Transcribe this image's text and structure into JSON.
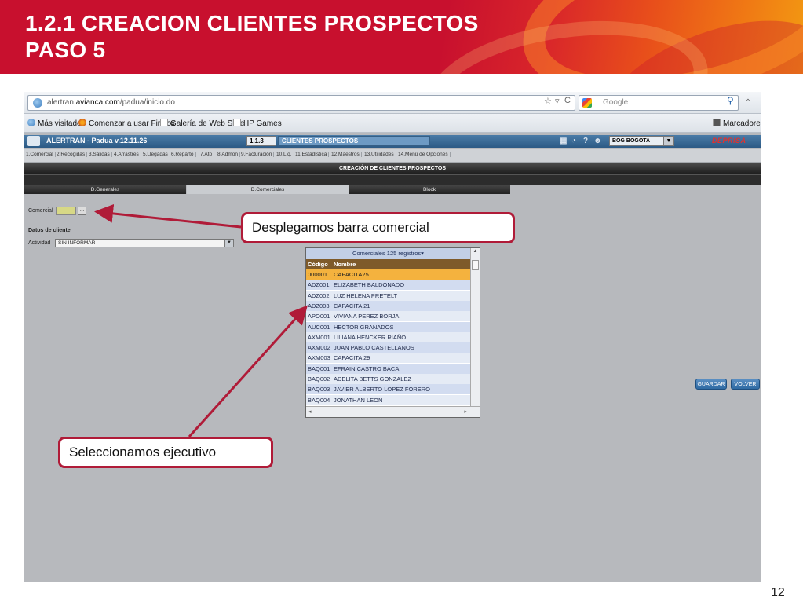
{
  "slide": {
    "title_line1": "1.2.1 CREACION CLIENTES PROSPECTOS",
    "title_line2": "PASO 5",
    "page_number": "12",
    "colors": {
      "header_red": "#c8102e",
      "header_orange": "#f39a12",
      "callout_border": "#b01b38"
    }
  },
  "browser": {
    "url_prefix": "alertran.",
    "url_domain": "avianca.com",
    "url_path": "/padua/inicio.do",
    "search_placeholder": "Google",
    "bookmarks": [
      "Más visitados",
      "Comenzar a usar Firefox",
      "Galería de Web Slice",
      "HP Games"
    ],
    "bookmarks_menu": "Marcadores"
  },
  "app": {
    "name": "ALERTRAN - Padua  v.12.11.26",
    "menu_code": "1.1.3",
    "menu_name": "CLIENTES PROSPECTOS",
    "branch": "BOG BOGOTA",
    "brand": "DEPRISA",
    "menu": [
      "1.Comercial",
      "2.Recogidas",
      "3.Salidas",
      "4.Arrastres",
      "5.Llegadas",
      "6.Reparto",
      "7.Ato",
      "8.Admon",
      "9.Facturación",
      "10.Liq.",
      "11.Estadística",
      "12.Maestros",
      "13.Utilidades",
      "14.Menú de Opciones"
    ],
    "section_title": "CREACIÓN DE CLIENTES PROSPECTOS",
    "tabs": [
      "D.Generales",
      "D.Comerciales",
      "Block"
    ],
    "active_tab": 1
  },
  "form": {
    "comercial_label": "Comercial",
    "comercial_button": "...",
    "datos_cliente_label": "Datos de cliente",
    "actividad_label": "Actividad",
    "actividad_value": "SIN INFORMAR"
  },
  "popup": {
    "title": "Comerciales 125 registros",
    "col_code": "Código",
    "col_name": "Nombre",
    "rows": [
      {
        "code": "000001",
        "name": "CAPACITA25"
      },
      {
        "code": "ADZ001",
        "name": "ELIZABETH BALDONADO"
      },
      {
        "code": "ADZ002",
        "name": "LUZ HELENA PRETELT"
      },
      {
        "code": "ADZ003",
        "name": "CAPACITA 21"
      },
      {
        "code": "APO001",
        "name": "VIVIANA PEREZ BORJA"
      },
      {
        "code": "AUC001",
        "name": "HECTOR GRANADOS"
      },
      {
        "code": "AXM001",
        "name": "LILIANA HENCKER RIAÑO"
      },
      {
        "code": "AXM002",
        "name": "JUAN PABLO CASTELLANOS"
      },
      {
        "code": "AXM003",
        "name": "CAPACITA 29"
      },
      {
        "code": "BAQ001",
        "name": "EFRAIN CASTRO BACA"
      },
      {
        "code": "BAQ002",
        "name": "ADELITA BETTS GONZALEZ"
      },
      {
        "code": "BAQ003",
        "name": "JAVIER ALBERTO LOPEZ FORERO"
      },
      {
        "code": "BAQ004",
        "name": "JONATHAN LEON"
      }
    ],
    "selected_row": 0
  },
  "buttons": {
    "guardar": "GUARDAR",
    "volver": "VOLVER"
  },
  "annotations": {
    "callout1": "Desplegamos barra comercial",
    "callout2": "Seleccionamos ejecutivo"
  }
}
